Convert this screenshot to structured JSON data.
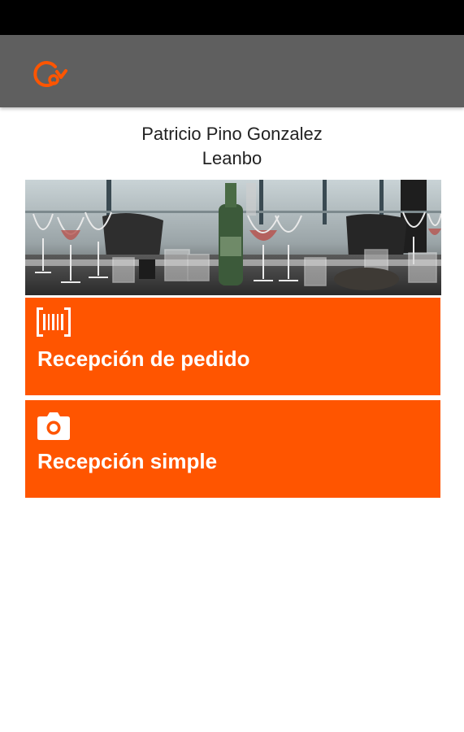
{
  "header": {
    "user_name": "Patricio Pino Gonzalez",
    "company": "Leanbo"
  },
  "actions": [
    {
      "label": "Recepción de pedido",
      "icon": "barcode-icon"
    },
    {
      "label": "Recepción simple",
      "icon": "camera-icon"
    }
  ],
  "colors": {
    "accent": "#ff5500",
    "app_bar": "#5f5f5f",
    "status_bar": "#000000"
  },
  "icons": {
    "logo": "refresh-logo-icon"
  }
}
